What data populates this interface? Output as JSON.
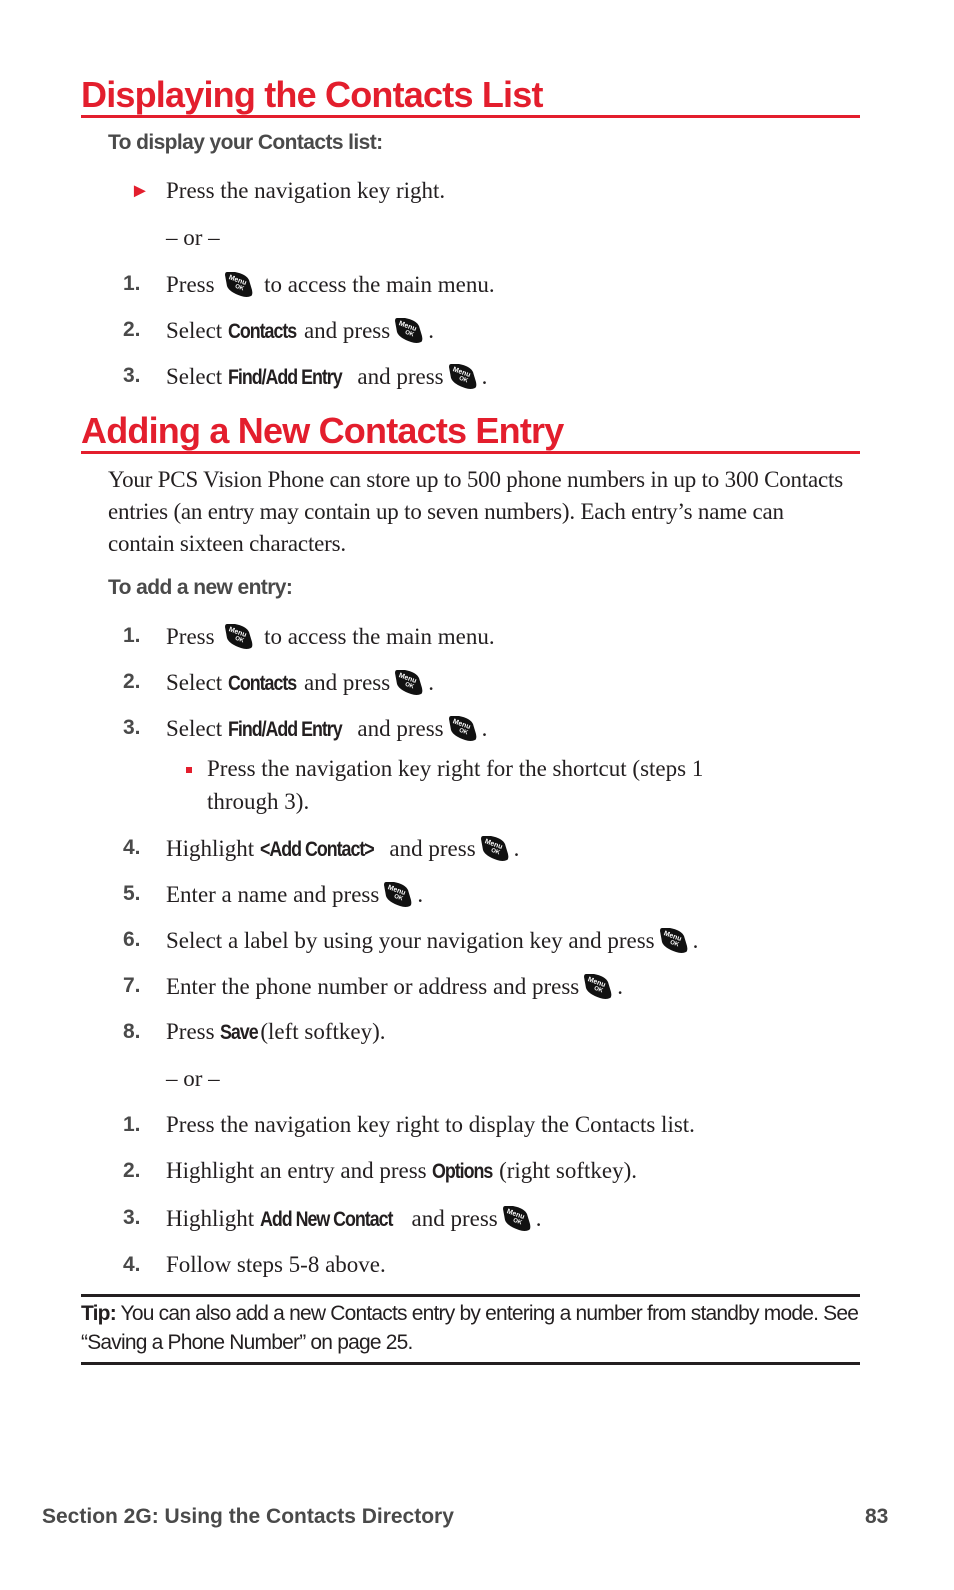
{
  "section1": {
    "title": "Displaying the Contacts List",
    "subheading": "To display your Contacts list:",
    "bullet": "Press the navigation key right.",
    "or": "– or –",
    "steps": [
      {
        "num": "1.",
        "pre": "Press",
        "bold": "",
        "post": "to access the main menu.",
        "key": "menu-ok-key"
      },
      {
        "num": "2.",
        "pre": "Select",
        "bold": "Contacts",
        "post": "and press",
        "key": "menu-ok-key",
        "end": "."
      },
      {
        "num": "3.",
        "pre": "Select",
        "bold": "Find/Add Entry",
        "post": "and press",
        "key": "menu-ok-key",
        "end": "."
      }
    ]
  },
  "section2": {
    "title": "Adding a New Contacts Entry",
    "intro": "Your PCS Vision Phone can store up to 500 phone numbers in up to 300 Contacts entries (an entry may contain up to seven numbers). Each entry’s name can contain sixteen characters.",
    "subheading": "To add a new entry:",
    "steps": [
      {
        "num": "1.",
        "pre": "Press",
        "post": "to access the main menu."
      },
      {
        "num": "2.",
        "pre": "Select",
        "bold": "Contacts",
        "post": "and press",
        "end": "."
      },
      {
        "num": "3.",
        "pre": "Select",
        "bold": "Find/Add Entry",
        "post": "and press",
        "end": "."
      },
      {
        "num": "4.",
        "pre": "Highlight",
        "bold": "<Add Contact>",
        "post": "and press",
        "end": "."
      },
      {
        "num": "5.",
        "pre": "Enter a name and press",
        "end": "."
      },
      {
        "num": "6.",
        "pre": "Select a label by using your navigation key and press",
        "end": "."
      },
      {
        "num": "7.",
        "pre": "Enter the phone number or address and press",
        "end": "."
      },
      {
        "num": "8.",
        "pre": "Press",
        "bold": "Save",
        "post": "(left softkey)."
      }
    ],
    "sub_bullet_line1": "Press the navigation key right for the shortcut (steps 1",
    "sub_bullet_line2": "through 3).",
    "or": "– or –",
    "alt_steps": [
      {
        "num": "1.",
        "pre": "Press the navigation key right to display the Contacts list."
      },
      {
        "num": "2.",
        "pre": "Highlight an entry and press",
        "bold": "Options",
        "post": "(right softkey)."
      },
      {
        "num": "3.",
        "pre": "Highlight",
        "bold": "Add New Contact",
        "post": "and press",
        "end": "."
      },
      {
        "num": "4.",
        "pre": "Follow steps 5-8 above."
      }
    ]
  },
  "tip": {
    "label": "Tip:",
    "text": " You can also add a new Contacts entry by entering a number from standby mode. See “Saving a Phone Number” on page 25."
  },
  "footer": {
    "section": "Section 2G: Using the Contacts Directory",
    "page": "83"
  },
  "icons": {
    "key_label_top": "Menu",
    "key_label_bottom": "OK"
  },
  "colors": {
    "accent": "#e31e2d",
    "text": "#231f20",
    "gray": "#4a4a4a"
  }
}
